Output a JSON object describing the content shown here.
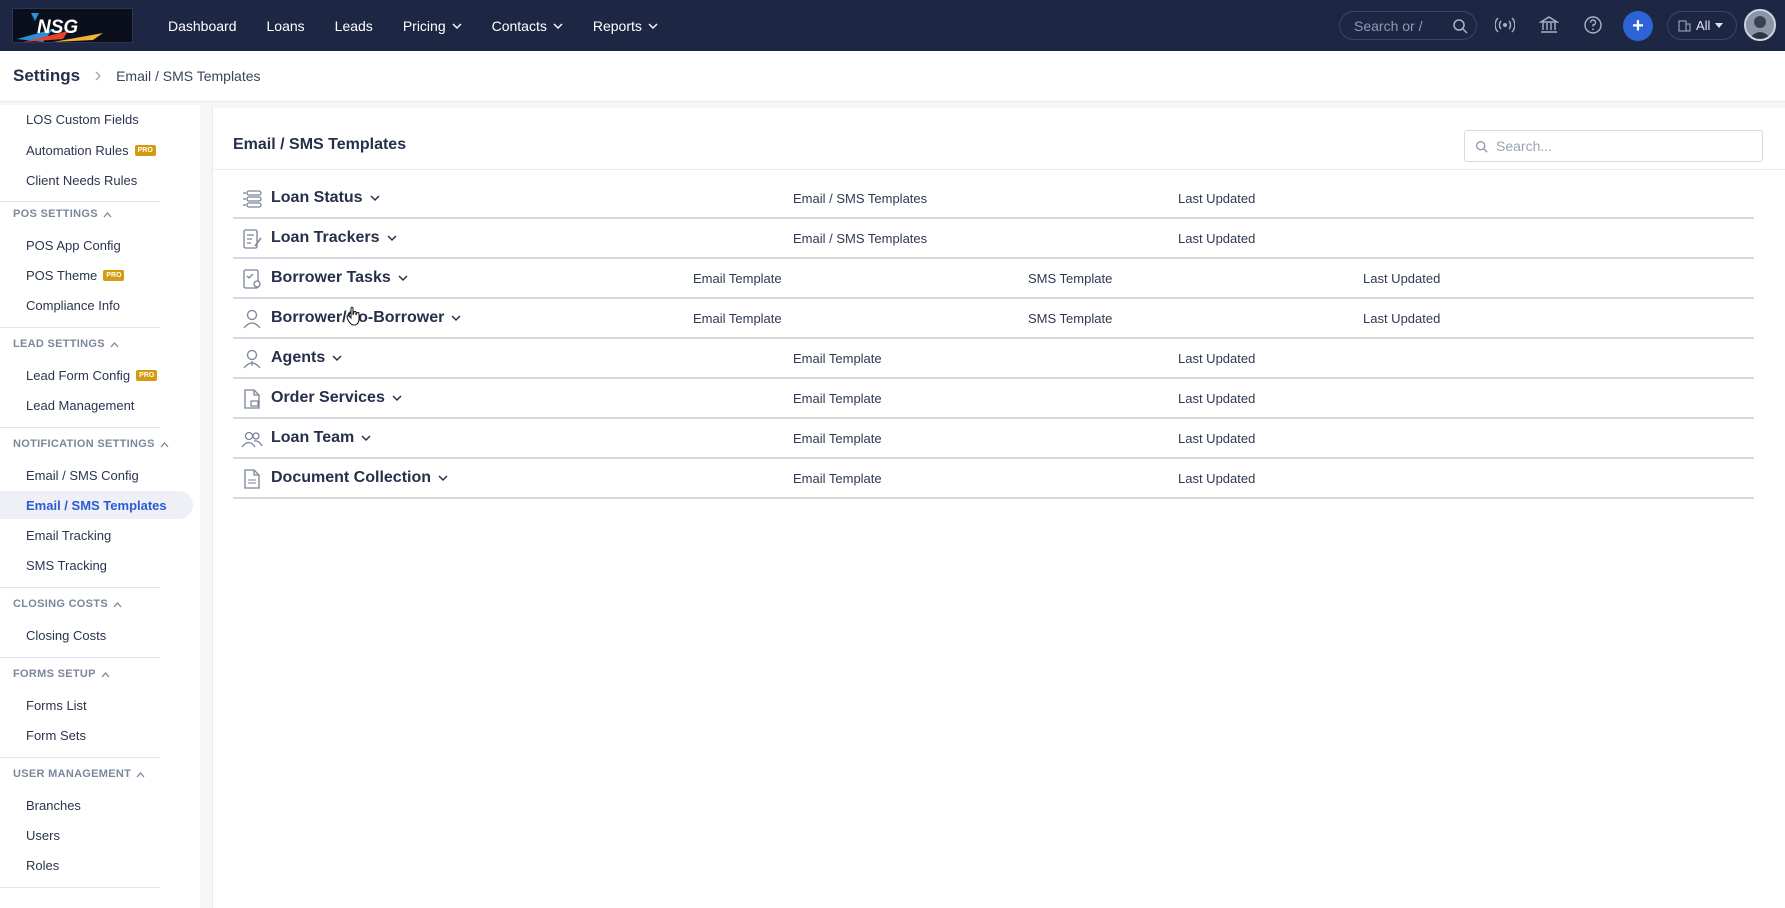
{
  "topnav": {
    "logo_text": "NSG",
    "items": [
      {
        "label": "Dashboard",
        "has_dropdown": false
      },
      {
        "label": "Loans",
        "has_dropdown": false
      },
      {
        "label": "Leads",
        "has_dropdown": false
      },
      {
        "label": "Pricing",
        "has_dropdown": true
      },
      {
        "label": "Contacts",
        "has_dropdown": true
      },
      {
        "label": "Reports",
        "has_dropdown": true
      }
    ],
    "search_placeholder": "Search or /",
    "icons": [
      "broadcast-icon",
      "bank-icon",
      "help-icon",
      "plus-icon"
    ],
    "scope_label": "All"
  },
  "breadcrumb": {
    "root": "Settings",
    "current": "Email / SMS Templates"
  },
  "sidebar": {
    "top_items": [
      {
        "label": "LOS Custom Fields",
        "pro": false
      },
      {
        "label": "Automation Rules",
        "pro": true
      },
      {
        "label": "Client Needs Rules",
        "pro": false
      }
    ],
    "sections": [
      {
        "title": "POS SETTINGS",
        "items": [
          {
            "label": "POS App Config",
            "pro": false
          },
          {
            "label": "POS Theme",
            "pro": true
          },
          {
            "label": "Compliance Info",
            "pro": false
          }
        ]
      },
      {
        "title": "LEAD SETTINGS",
        "items": [
          {
            "label": "Lead Form Config",
            "pro": true
          },
          {
            "label": "Lead Management",
            "pro": false
          }
        ]
      },
      {
        "title": "NOTIFICATION SETTINGS",
        "items": [
          {
            "label": "Email / SMS Config",
            "pro": false
          },
          {
            "label": "Email / SMS Templates",
            "pro": false,
            "active": true
          },
          {
            "label": "Email Tracking",
            "pro": false
          },
          {
            "label": "SMS Tracking",
            "pro": false
          }
        ]
      },
      {
        "title": "CLOSING COSTS",
        "items": [
          {
            "label": "Closing Costs",
            "pro": false
          }
        ]
      },
      {
        "title": "FORMS SETUP",
        "items": [
          {
            "label": "Forms List",
            "pro": false
          },
          {
            "label": "Form Sets",
            "pro": false
          }
        ]
      },
      {
        "title": "USER MANAGEMENT",
        "items": [
          {
            "label": "Branches",
            "pro": false
          },
          {
            "label": "Users",
            "pro": false
          },
          {
            "label": "Roles",
            "pro": false
          }
        ]
      }
    ],
    "pro_badge": "PRO"
  },
  "main": {
    "title": "Email / SMS Templates",
    "search_placeholder": "Search...",
    "rows": [
      {
        "title": "Loan Status",
        "icon": "status-list-icon",
        "cols": [
          "Email / SMS Templates",
          "Last Updated"
        ]
      },
      {
        "title": "Loan Trackers",
        "icon": "tracker-icon",
        "cols": [
          "Email / SMS Templates",
          "Last Updated"
        ]
      },
      {
        "title": "Borrower Tasks",
        "icon": "task-checklist-icon",
        "cols": [
          "Email Template",
          "SMS Template",
          "Last Updated"
        ]
      },
      {
        "title": "Borrower/Co-Borrower",
        "icon": "person-icon",
        "cols": [
          "Email Template",
          "SMS Template",
          "Last Updated"
        ]
      },
      {
        "title": "Agents",
        "icon": "agent-icon",
        "cols": [
          "Email Template",
          "Last Updated"
        ]
      },
      {
        "title": "Order Services",
        "icon": "order-document-icon",
        "cols": [
          "Email Template",
          "Last Updated"
        ]
      },
      {
        "title": "Loan Team",
        "icon": "team-icon",
        "cols": [
          "Email Template",
          "Last Updated"
        ]
      },
      {
        "title": "Document Collection",
        "icon": "pdf-document-icon",
        "cols": [
          "Email Template",
          "Last Updated"
        ]
      }
    ]
  },
  "colors": {
    "topbar": "#1d2744",
    "accent": "#2a5bd7",
    "pro_badge": "#d49a10",
    "plus_button": "#2e63d6"
  }
}
